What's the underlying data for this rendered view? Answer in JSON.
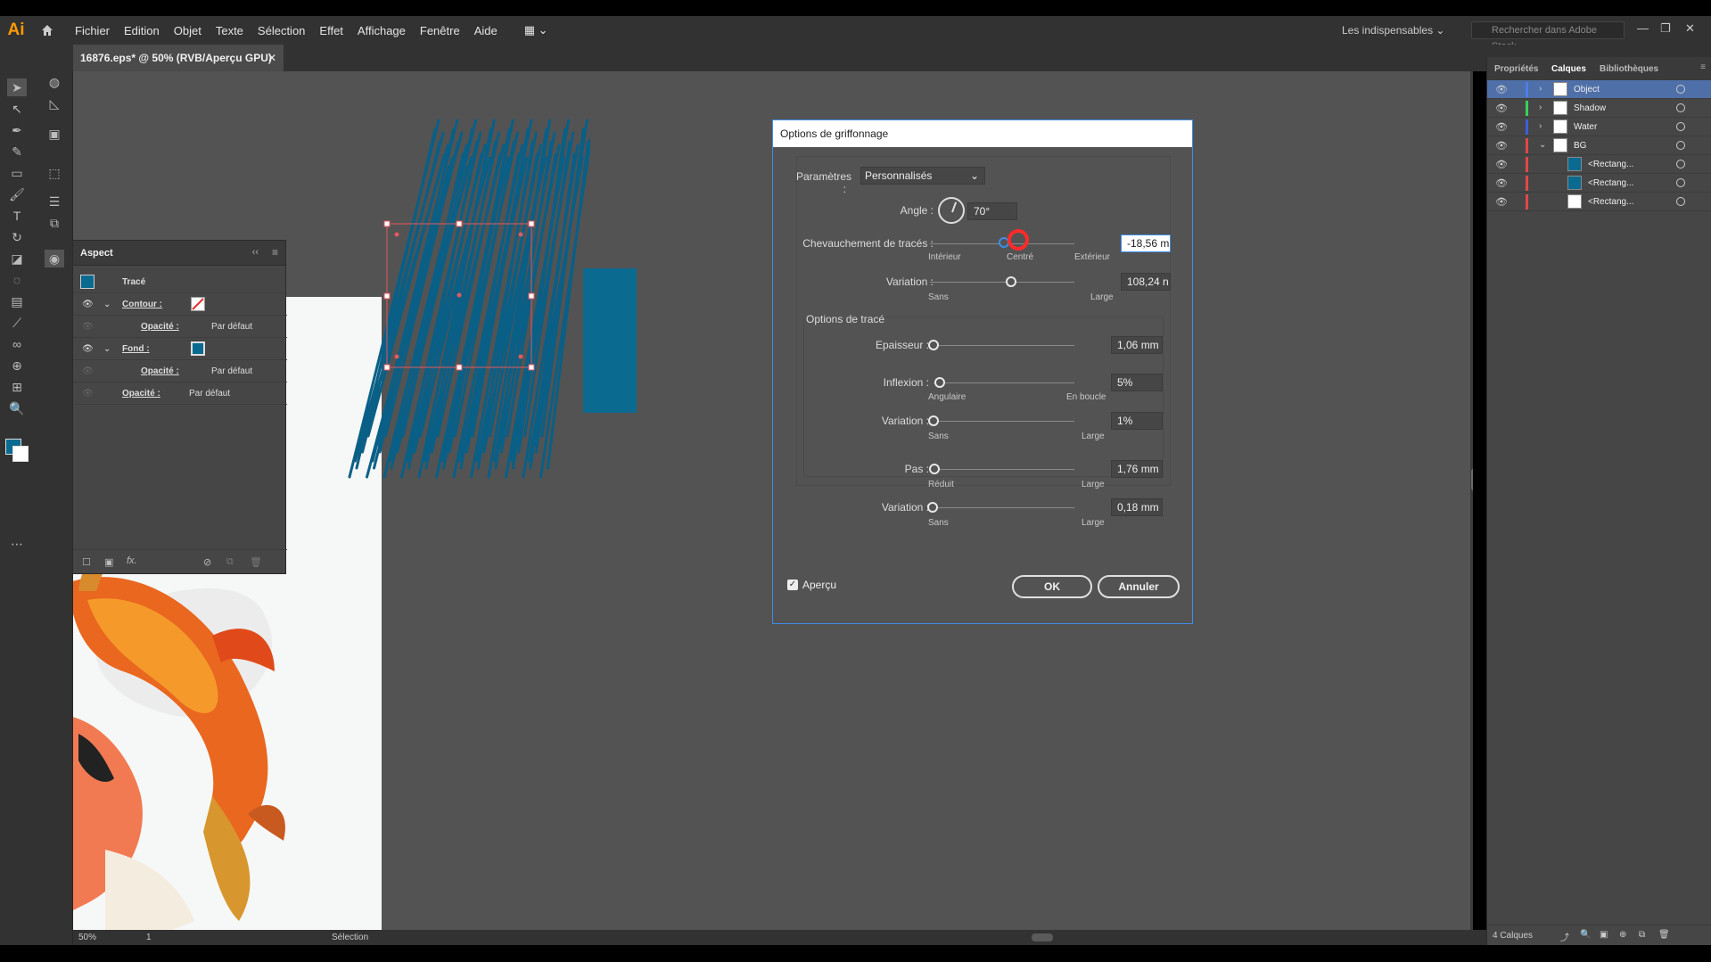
{
  "app": {
    "logo": "Ai"
  },
  "menu": [
    "Fichier",
    "Edition",
    "Objet",
    "Texte",
    "Sélection",
    "Effet",
    "Affichage",
    "Fenêtre",
    "Aide"
  ],
  "workspace": "Les indispensables",
  "stock_search_placeholder": "Rechercher dans Adobe Stock",
  "document_tab": "16876.eps* @ 50% (RVB/Aperçu GPU)",
  "colors": {
    "accent": "#3d8ee8",
    "scribble": "#0a5f86",
    "rect": "#0b6a90",
    "selection": "#e05a60"
  },
  "aspect_panel": {
    "title": "Aspect",
    "object": "Tracé",
    "rows": [
      {
        "label": "Contour :",
        "value": ""
      },
      {
        "label": "Opacité :",
        "value": "Par défaut"
      },
      {
        "label": "Fond :",
        "value": ""
      },
      {
        "label": "Opacité :",
        "value": "Par défaut"
      },
      {
        "label": "Opacité :",
        "value": "Par défaut"
      }
    ],
    "fx": "fx."
  },
  "dialog": {
    "title": "Options de griffonnage",
    "params_label": "Paramètres :",
    "params_value": "Personnalisés",
    "angle_label": "Angle :",
    "angle_value": "70°",
    "overlap": {
      "label": "Chevauchement de tracés :",
      "value": "-18,56 m",
      "min": "Intérieur",
      "mid": "Centré",
      "max": "Extérieur"
    },
    "overlap_variation": {
      "label": "Variation :",
      "value": "108,24 n",
      "min": "Sans",
      "max": "Large"
    },
    "section": "Options de tracé",
    "thickness": {
      "label": "Epaisseur :",
      "value": "1,06 mm"
    },
    "inflexion": {
      "label": "Inflexion :",
      "value": "5%",
      "min": "Angulaire",
      "max": "En boucle"
    },
    "inflexion_variation": {
      "label": "Variation :",
      "value": "1%",
      "min": "Sans",
      "max": "Large"
    },
    "step": {
      "label": "Pas :",
      "value": "1,76 mm",
      "min": "Réduit",
      "max": "Large"
    },
    "step_variation": {
      "label": "Variation :",
      "value": "0,18 mm",
      "min": "Sans",
      "max": "Large"
    },
    "preview_label": "Aperçu",
    "ok": "OK",
    "cancel": "Annuler"
  },
  "right_panel": {
    "tabs": [
      "Propriétés",
      "Calques",
      "Bibliothèques"
    ],
    "layers": [
      {
        "name": "Object",
        "color": "#4f7de8"
      },
      {
        "name": "Shadow",
        "color": "#3bd05a"
      },
      {
        "name": "Water",
        "color": "#3d5fd6"
      },
      {
        "name": "BG",
        "color": "#e04848"
      },
      {
        "name": "<Rectang...",
        "color": "#e04848"
      },
      {
        "name": "<Rectang...",
        "color": "#e04848"
      },
      {
        "name": "<Rectang...",
        "color": "#e04848"
      }
    ],
    "footer": "4 Calques"
  },
  "status": {
    "zoom": "50%",
    "page": "1",
    "tool": "Sélection"
  }
}
